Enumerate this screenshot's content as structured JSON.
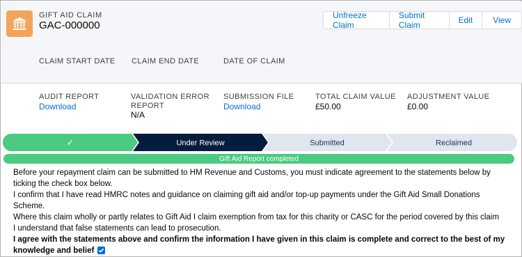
{
  "record": {
    "object_label": "GIFT AID CLAIM",
    "name": "GAC-000000",
    "icon": "bank-icon"
  },
  "actions": [
    "Unfreeze Claim",
    "Submit Claim",
    "Edit",
    "View"
  ],
  "header_fields": [
    "CLAIM START DATE",
    "CLAIM END DATE",
    "DATE OF CLAIM"
  ],
  "details": {
    "audit_report": {
      "label": "AUDIT REPORT",
      "value": "Download"
    },
    "validation_error_report": {
      "label_line1": "VALIDATION ERROR",
      "label_line2": "REPORT",
      "value": "N/A"
    },
    "submission_file": {
      "label": "SUBMISSION FILE",
      "value": "Download"
    },
    "total_claim_value": {
      "label": "TOTAL CLAIM VALUE",
      "value": "£50.00"
    },
    "adjustment_value": {
      "label": "ADJUSTMENT VALUE",
      "value": "£0.00"
    }
  },
  "path": {
    "stages": [
      "✓",
      "Under Review",
      "Submitted",
      "Reclaimed"
    ],
    "current": "Under Review",
    "colors": {
      "complete": "#4bca81",
      "current": "#061c3f",
      "incomplete": "#e0e5ee"
    }
  },
  "banner": "Gift Aid Report completed",
  "declaration": {
    "intro": "Before your repayment claim can be submitted to HM Revenue and Customs, you must indicate agreement to the statements below by ticking the check box below.",
    "line1": "I confirm that I have read HMRC notes and guidance on claiming gift aid and/or top-up payments under the Gift Aid Small Donations Scheme.",
    "line2": "Where this claim wholly or partly relates to Gift Aid I claim exemption from tax for this charity or CASC for the period covered by this claim",
    "line3": "I understand that false statements can lead to prosecution.",
    "agree": "I agree with the statements above and confirm the information I have given in this claim is complete and correct to the best of my knowledge and belief",
    "agreed": true
  }
}
